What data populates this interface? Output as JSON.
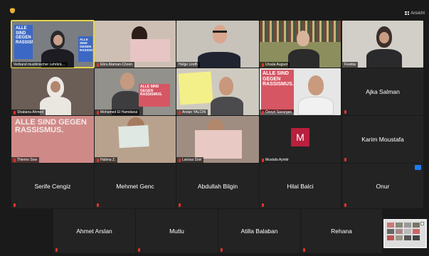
{
  "toolbar": {
    "view_label": "Ansicht"
  },
  "icons": {
    "security": "shield-icon",
    "view": "grid-view-icon",
    "mic": "mic-muted-icon"
  },
  "colors": {
    "active_speaker": "#e8d44d",
    "muted": "#e0342c",
    "avatar_bg": "#b8203e",
    "tile_bg": "#232323"
  },
  "tiles": [
    {
      "name": "Verband muslimischer Lehrkrä…",
      "poster": "ALLE SIND GEGEN RASSISMUS.",
      "active": true
    },
    {
      "name": "Ebru Ataman-Cözen"
    },
    {
      "name": "Helge Lindh"
    },
    {
      "name": "Ursula August"
    },
    {
      "name": "Fereba"
    },
    {
      "name": "Shabana Ahmed"
    },
    {
      "name": "Mohamed El Hamdaoui",
      "poster": "ALLE SIND GEGEN RASSISMUS."
    },
    {
      "name": "Arslan YALCIN"
    },
    {
      "name": "Özeyir Savurgan",
      "poster": "ALLE SIND GEGEN RASSISMUS."
    },
    {
      "name": "Ajka Salman"
    },
    {
      "name": "Thierno Sow",
      "poster": "ALLE SIND GEGEN RASSISMUS."
    },
    {
      "name": "Halima Z."
    },
    {
      "name": "Larissa Sow"
    },
    {
      "name": "Mustafa Ayintir",
      "avatar": "M"
    },
    {
      "name": "Karim Moustafa"
    },
    {
      "name": "Serife Cengiz"
    },
    {
      "name": "Mehmet Genc"
    },
    {
      "name": "Abdullah Bilgin"
    },
    {
      "name": "Hilal Balci"
    },
    {
      "name": "Onur"
    },
    {
      "name": "Ahmet Arslan"
    },
    {
      "name": "Mutlu"
    },
    {
      "name": "Atilla Balaban"
    },
    {
      "name": "Rehana"
    }
  ]
}
